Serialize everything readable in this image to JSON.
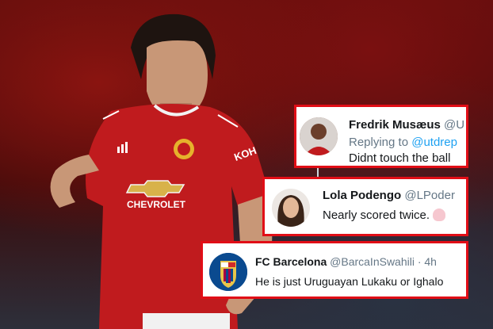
{
  "tweets": [
    {
      "name": "Fredrik Musæus",
      "handle": "@U",
      "reply_prefix": "Replying to ",
      "reply_to": "@utdrep",
      "text": "Didnt touch the ball"
    },
    {
      "name": "Lola Podengo",
      "handle": "@LPoder",
      "text": "Nearly scored twice.",
      "emoji": "woman-facepalming"
    },
    {
      "name": "FC Barcelona",
      "handle": "@BarcaInSwahili",
      "time": "· 4h",
      "text": "He is just Uruguayan Lukaku or  Ighalo"
    }
  ],
  "photo": {
    "kit_sponsor": "CHEVROLET",
    "sleeve_text": "KOH",
    "crest": "manchester-united-crest-icon",
    "kit_brand": "adidas-logo-icon"
  },
  "colors": {
    "highlight_border": "#e10d16",
    "kit_red": "#c01b1e",
    "link_blue": "#1da1f2",
    "barca_blue": "#0a4a8f",
    "barca_red": "#a50044"
  }
}
